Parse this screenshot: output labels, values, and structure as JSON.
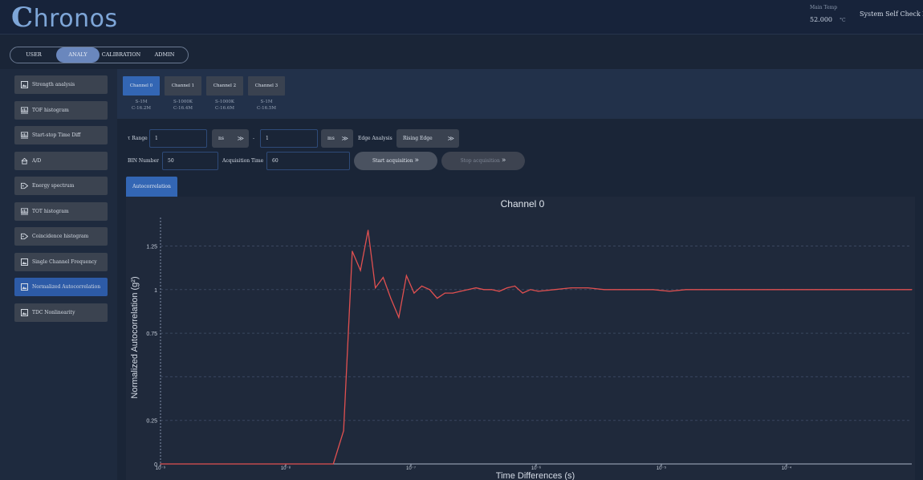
{
  "app": {
    "logo_first": "C",
    "logo_rest": "hronos",
    "temp_label": "Main Temp",
    "temp_value": "52.000",
    "temp_unit": "°C",
    "self_check": "System Self Check X"
  },
  "mode_tabs": [
    {
      "label": "USER",
      "active": false
    },
    {
      "label": "ANALY",
      "active": true
    },
    {
      "label": "CALIBRATION",
      "active": false
    },
    {
      "label": "ADMIN",
      "active": false
    }
  ],
  "sidebar": {
    "items": [
      {
        "label": "Strength analysis",
        "icon": "image-icon",
        "active": false
      },
      {
        "label": "TOF histogram",
        "icon": "histogram-icon",
        "active": false
      },
      {
        "label": "Start-stop Time Diff",
        "icon": "histogram-icon",
        "active": false
      },
      {
        "label": "A/D",
        "icon": "home-icon",
        "active": false
      },
      {
        "label": "Energy spectrum",
        "icon": "tag-icon",
        "active": false
      },
      {
        "label": "TOT histogram",
        "icon": "histogram-icon",
        "active": false
      },
      {
        "label": "Coincidence histogram",
        "icon": "tag-icon",
        "active": false
      },
      {
        "label": "Single Channel Frequency",
        "icon": "image-icon",
        "active": false
      },
      {
        "label": "Normalized Autocorrelation",
        "icon": "image-icon",
        "active": true
      },
      {
        "label": "TDC Nonlinearity",
        "icon": "image-icon",
        "active": false
      }
    ]
  },
  "channels": [
    {
      "label": "Channel 0",
      "line1": "S-1M",
      "line2": "C-16.2M",
      "active": true
    },
    {
      "label": "Channel 1",
      "line1": "S-1000K",
      "line2": "C-16.4M",
      "active": false
    },
    {
      "label": "Channel 2",
      "line1": "S-1000K",
      "line2": "C-16.6M",
      "active": false
    },
    {
      "label": "Channel 3",
      "line1": "S-1M",
      "line2": "C-16.5M",
      "active": false
    }
  ],
  "controls": {
    "tau_range_label": "τ Range",
    "tau_min": "1",
    "tau_min_unit": "ns",
    "dash": "-",
    "tau_max": "1",
    "tau_max_unit": "ms",
    "edge_label": "Edge Analysis",
    "edge_value": "Rising Edge",
    "bin_label": "BIN Number",
    "bin_value": "50",
    "acq_label": "Acquisition Time",
    "acq_value": "60",
    "start_label": "Start acquisition",
    "stop_label": "Stop acquisition",
    "chevron": "»",
    "dropdown_chevron": "≫"
  },
  "sub_tab": {
    "label": "Autocorrelation"
  },
  "chart_data": {
    "type": "line",
    "title": "Channel 0",
    "xlabel": "Time Differences (s)",
    "ylabel": "Normalized Autocorrelation (g²)",
    "x_scale": "log",
    "xlim": [
      1e-09,
      0.001
    ],
    "ylim": [
      0,
      1.45
    ],
    "yticks": [
      0,
      0.25,
      0.5,
      0.75,
      1,
      1.25
    ],
    "ytick_labels": [
      "0",
      "0.25",
      "0.75",
      "1",
      "1.25"
    ],
    "xtick_labels": [
      "10⁻⁹",
      "10⁻⁸",
      "10⁻⁷",
      "10⁻⁶",
      "10⁻⁵",
      "10⁻⁴"
    ],
    "xticks": [
      1e-09,
      1e-08,
      1e-07,
      1e-06,
      1e-05,
      0.0001
    ],
    "grid": "horizontal dashed",
    "line_color": "#e05050",
    "series": [
      {
        "x": [
          1e-09,
          2.4e-08,
          2.9e-08,
          3.4e-08,
          3.95e-08,
          4.55e-08,
          5.2e-08,
          6e-08,
          6.9e-08,
          8e-08,
          9.2e-08,
          1.06e-07,
          1.22e-07,
          1.41e-07,
          1.62e-07,
          1.87e-07,
          2.16e-07,
          2.49e-07,
          2.87e-07,
          3.31e-07,
          3.82e-07,
          4.4e-07,
          5.08e-07,
          5.86e-07,
          6.76e-07,
          7.8e-07,
          9e-07,
          1.04e-06,
          1.4e-06,
          1.9e-06,
          2.6e-06,
          3.5e-06,
          4.7e-06,
          6.4e-06,
          8.6e-06,
          1.16e-05,
          1.57e-05,
          2.1e-05,
          2.9e-05,
          3.9e-05,
          5.2e-05,
          7e-05,
          9.5e-05,
          0.000128,
          0.00017,
          0.00023,
          0.00031,
          0.00042,
          0.00057,
          0.00077,
          0.001
        ],
        "y": [
          0,
          0,
          0.19,
          1.22,
          1.11,
          1.34,
          1.01,
          1.07,
          0.95,
          0.84,
          1.08,
          0.98,
          1.02,
          1.0,
          0.95,
          0.98,
          0.98,
          0.99,
          1.0,
          1.01,
          1.0,
          1.0,
          0.99,
          1.01,
          1.02,
          0.98,
          1.0,
          0.99,
          1.0,
          1.01,
          1.01,
          1.0,
          1.0,
          1.0,
          1.0,
          0.99,
          1.0,
          1.0,
          1.0,
          1.0,
          1.0,
          1.0,
          1.0,
          1.0,
          1.0,
          1.0,
          1.0,
          1.0,
          1.0,
          1.0,
          1.0
        ]
      }
    ]
  }
}
